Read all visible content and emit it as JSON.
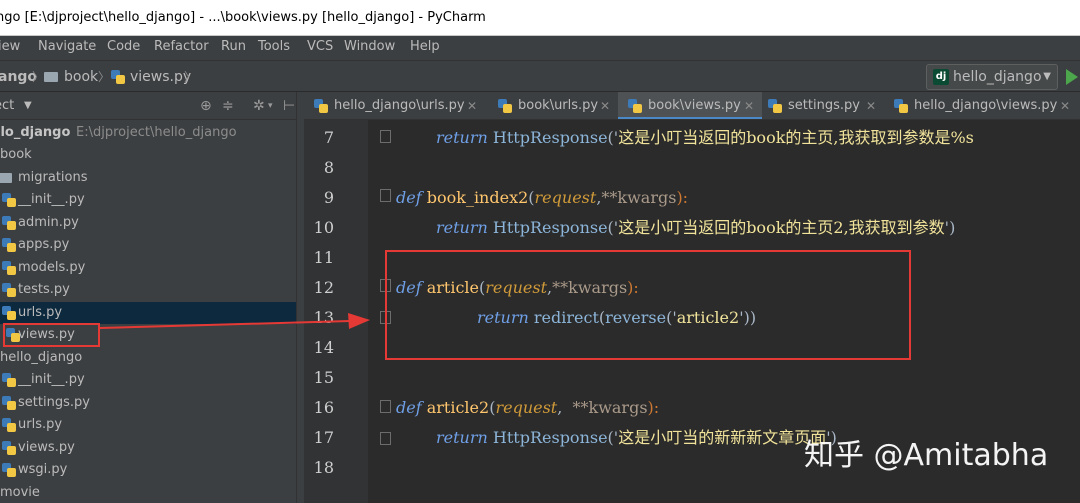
{
  "window": {
    "title": "ngo [E:\\djproject\\hello_django] - ...\\book\\views.py [hello_django] - PyCharm"
  },
  "menu": {
    "items": [
      "iew",
      "Navigate",
      "Code",
      "Refactor",
      "Run",
      "Tools",
      "VCS",
      "Window",
      "Help"
    ]
  },
  "navbar": {
    "crumbs": [
      "ango",
      "book",
      "views.py"
    ],
    "run_config": "hello_django"
  },
  "project_panel": {
    "title": "ect",
    "rows": [
      {
        "label": "llo_django",
        "hint": "E:\\djproject\\hello_django",
        "icon": "folder-icon"
      },
      {
        "label": "book",
        "hint": "",
        "icon": "folder-icon"
      },
      {
        "label": "migrations",
        "hint": "",
        "icon": "folder-icon"
      },
      {
        "label": "__init__.py",
        "hint": "",
        "icon": "python-file-icon"
      },
      {
        "label": "admin.py",
        "hint": "",
        "icon": "python-file-icon"
      },
      {
        "label": "apps.py",
        "hint": "",
        "icon": "python-file-icon"
      },
      {
        "label": "models.py",
        "hint": "",
        "icon": "python-file-icon"
      },
      {
        "label": "tests.py",
        "hint": "",
        "icon": "python-file-icon"
      },
      {
        "label": "urls.py",
        "hint": "",
        "icon": "python-file-icon"
      },
      {
        "label": "views.py",
        "hint": "",
        "icon": "python-file-icon"
      },
      {
        "label": "hello_django",
        "hint": "",
        "icon": "folder-icon"
      },
      {
        "label": "__init__.py",
        "hint": "",
        "icon": "python-file-icon"
      },
      {
        "label": "settings.py",
        "hint": "",
        "icon": "python-file-icon"
      },
      {
        "label": "urls.py",
        "hint": "",
        "icon": "python-file-icon"
      },
      {
        "label": "views.py",
        "hint": "",
        "icon": "python-file-icon"
      },
      {
        "label": "wsgi.py",
        "hint": "",
        "icon": "python-file-icon"
      },
      {
        "label": "movie",
        "hint": "",
        "icon": "folder-icon"
      }
    ]
  },
  "tabs": [
    {
      "label": "hello_django\\urls.py",
      "active": false
    },
    {
      "label": "book\\urls.py",
      "active": false
    },
    {
      "label": "book\\views.py",
      "active": true
    },
    {
      "label": "settings.py",
      "active": false
    },
    {
      "label": "hello_django\\views.py",
      "active": false
    }
  ],
  "editor": {
    "line_numbers": [
      "7",
      "8",
      "9",
      "10",
      "11",
      "12",
      "13",
      "14",
      "15",
      "16",
      "17",
      "18"
    ],
    "lines": {
      "l7": {
        "kw": "return",
        "cls": "HttpResponse",
        "open": "('",
        "str": "这是小叮当返回的book的主页,我获取到参数是%s"
      },
      "l9": {
        "kw": "def",
        "fn": "book_index2",
        "open": "(",
        "p1": "request",
        "sep": ",",
        "star": "**",
        "kw2": "kwargs",
        "close": "):"
      },
      "l10": {
        "kw": "return",
        "cls": "HttpResponse",
        "open": "('",
        "str": "这是小叮当返回的book的主页2,我获取到参数",
        "close": "')"
      },
      "l12": {
        "kw": "def",
        "fn": "article",
        "open": "(",
        "p1": "request",
        "sep": ",",
        "star": "**",
        "kw2": "kwargs",
        "close": "):"
      },
      "l13": {
        "kw": "return",
        "fn1": "redirect",
        "open1": "(",
        "fn2": "reverse",
        "open2": "('",
        "str": "article2",
        "close": "'))"
      },
      "l16": {
        "kw": "def",
        "fn": "article2",
        "open": "(",
        "p1": "request",
        "sep": ",  ",
        "star": "**",
        "kw2": "kwargs",
        "close": "):"
      },
      "l17": {
        "kw": "return",
        "cls": "HttpResponse",
        "open": "('",
        "str": "这是小叮当的新新新文章页面",
        "close": "')"
      }
    }
  },
  "watermark": "知乎 @Amitabha",
  "colors": {
    "annotation_red": "#e53935",
    "tab_active_underline": "#4a88c7",
    "selection": "#0d293e"
  }
}
